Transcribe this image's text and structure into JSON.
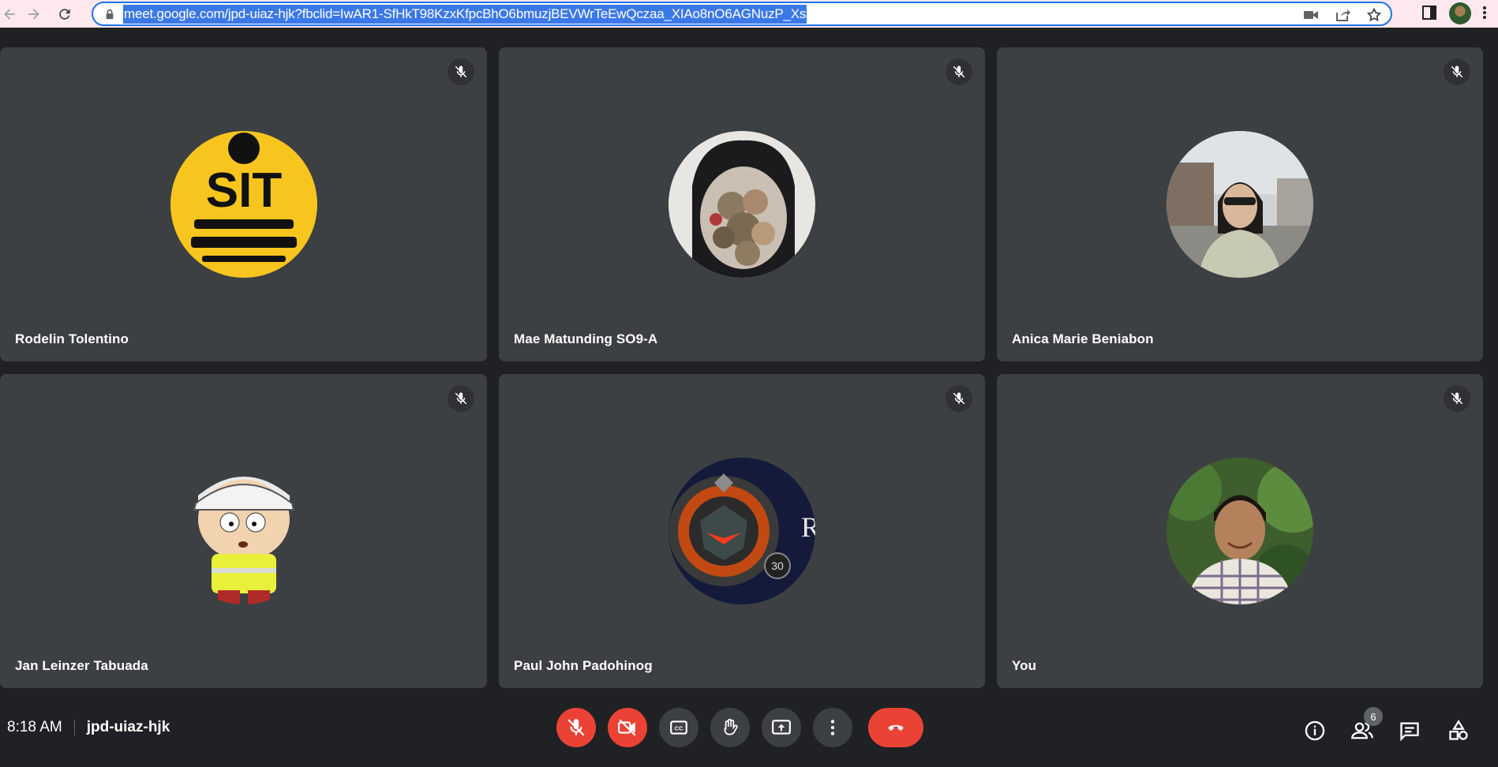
{
  "browser": {
    "url": "meet.google.com/jpd-uiaz-hjk?fbclid=IwAR1-SfHkT98KzxKfpcBhO6bmuzjBEVWrTeEwQczaa_XIAo8nO6AGNuzP_Xs"
  },
  "participants": [
    {
      "name": "Rodelin Tolentino",
      "avatar": "sit-logo"
    },
    {
      "name": "Mae Matunding SO9-A",
      "avatar": "flowers-photo"
    },
    {
      "name": "Anica Marie Beniabon",
      "avatar": "woman-photo"
    },
    {
      "name": "Jan Leinzer Tabuada",
      "avatar": "cartoon-character"
    },
    {
      "name": "Paul John Padohinog",
      "avatar": "game-emblem"
    },
    {
      "name": "You",
      "avatar": "man-photo"
    }
  ],
  "avatar_texts": {
    "sit": "SIT",
    "level": "30",
    "emblem_letter": "R"
  },
  "meeting": {
    "time": "8:18 AM",
    "code": "jpd-uiaz-hjk",
    "people_count": "6"
  },
  "colors": {
    "tile_bg": "#3c4043",
    "page_bg": "#202124",
    "hangup_red": "#ea4335",
    "url_highlight": "#3b78e7"
  }
}
